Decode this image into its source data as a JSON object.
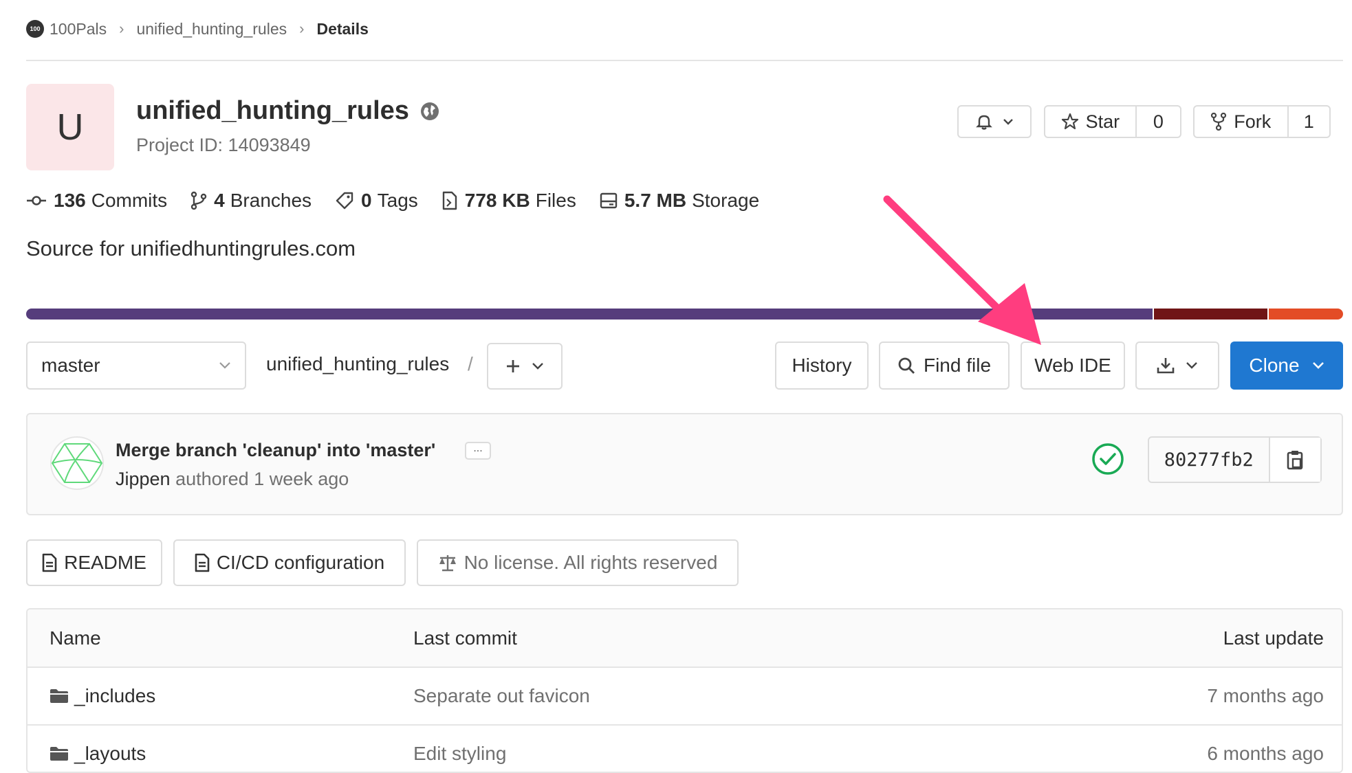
{
  "breadcrumb": {
    "org_logo_text": "100",
    "org": "100Pals",
    "repo": "unified_hunting_rules",
    "current": "Details"
  },
  "project": {
    "avatar_letter": "U",
    "name": "unified_hunting_rules",
    "id_label": "Project ID: 14093849",
    "visibility_icon": "globe-icon",
    "description": "Source for unifiedhuntingrules.com"
  },
  "actions": {
    "star_label": "Star",
    "star_count": "0",
    "fork_label": "Fork",
    "fork_count": "1"
  },
  "stats": [
    {
      "icon": "commit-icon",
      "value": "136",
      "label": "Commits"
    },
    {
      "icon": "branch-icon",
      "value": "4",
      "label": "Branches"
    },
    {
      "icon": "tag-icon",
      "value": "0",
      "label": "Tags"
    },
    {
      "icon": "file-icon",
      "value": "778 KB",
      "label": "Files"
    },
    {
      "icon": "storage-icon",
      "value": "5.7 MB",
      "label": "Storage"
    }
  ],
  "language_bar": {
    "colors": [
      "#563d7c",
      "#701516",
      "#e34c26"
    ]
  },
  "toolbar": {
    "branch": "master",
    "path": "unified_hunting_rules",
    "path_sep": "/",
    "history": "History",
    "find_file": "Find file",
    "web_ide": "Web IDE",
    "clone": "Clone"
  },
  "commit": {
    "title": "Merge branch 'cleanup' into 'master'",
    "ellipsis": "...",
    "author": "Jippen",
    "meta": "authored 1 week ago",
    "sha": "80277fb2",
    "status_color": "#1aaa55"
  },
  "quick_links": {
    "readme": "README",
    "cicd": "CI/CD configuration",
    "license": "No license. All rights reserved"
  },
  "table": {
    "headers": {
      "name": "Name",
      "last_commit": "Last commit",
      "last_update": "Last update"
    },
    "rows": [
      {
        "name": "_includes",
        "commit": "Separate out favicon",
        "updated": "7 months ago"
      },
      {
        "name": "_layouts",
        "commit": "Edit styling",
        "updated": "6 months ago"
      }
    ]
  },
  "colors": {
    "accent": "#1f78d1",
    "annotation_arrow": "#ff3d7f"
  }
}
